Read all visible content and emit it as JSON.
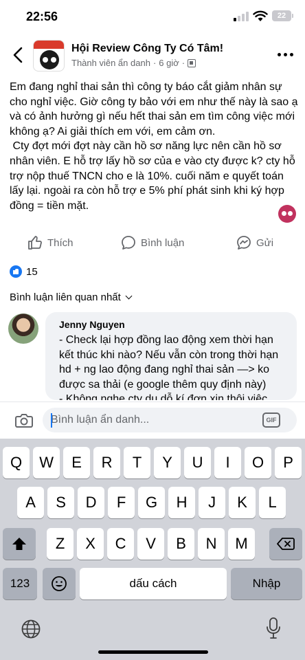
{
  "status_bar": {
    "time": "22:56",
    "battery": "22"
  },
  "header": {
    "group_name": "Hội Review Công Ty Có Tâm!",
    "author": "Thành viên ẩn danh",
    "separator": "·",
    "time_ago": "6 giờ",
    "separator2": "·"
  },
  "post": {
    "text": "Em đang nghỉ thai sản thì công ty báo cắt giảm nhân sự cho nghỉ việc. Giờ công ty bảo với em như thế này là sao ạ và có ảnh hưởng gì nếu hết thai sản em tìm công việc mới không ạ? Ai giải thích em với, em cảm ơn.\n Cty đợt mới đợt này cần hồ sơ năng lực nên cần hồ sơ nhân viên. E hỗ trợ lấy hồ sơ của e vào cty được k? cty hỗ trợ nộp thuế TNCN cho e là 10%. cuối năm e quyết toán lấy lại. ngoài ra còn hỗ trợ e 5% phí phát sinh khi ký hợp đồng = tiền mặt."
  },
  "actions": {
    "like": "Thích",
    "comment": "Bình luận",
    "send": "Gửi"
  },
  "reactions": {
    "count": "15"
  },
  "comments_sort": "Bình luận liên quan nhất",
  "comment": {
    "author": "Jenny Nguyen",
    "text": "- Check lại hợp đồng lao động xem thời hạn kết thúc khi nào? Nếu vẫn còn trong thời hạn hd + ng lao động đang nghỉ thai sản —> ko được sa thải (e google thêm quy định này)\n- Không nghe cty du dỗ kí đơn xin thôi việc"
  },
  "composer": {
    "placeholder": "Bình luận ẩn danh...",
    "gif_label": "GIF"
  },
  "keyboard": {
    "row1": [
      "Q",
      "W",
      "E",
      "R",
      "T",
      "Y",
      "U",
      "I",
      "O",
      "P"
    ],
    "row2": [
      "A",
      "S",
      "D",
      "F",
      "G",
      "H",
      "J",
      "K",
      "L"
    ],
    "row3": [
      "Z",
      "X",
      "C",
      "V",
      "B",
      "N",
      "M"
    ],
    "numbers_label": "123",
    "space_label": "dấu cách",
    "return_label": "Nhập"
  },
  "colors": {
    "brand_blue": "#1877f2",
    "secondary_text": "#65676b",
    "bubble_bg": "#f0f2f5",
    "keyboard_bg": "#d1d3d9"
  },
  "icons": [
    "back-icon",
    "more-icon",
    "like-icon",
    "comment-icon",
    "send-icon",
    "camera-icon",
    "gif-icon",
    "shift-icon",
    "delete-icon",
    "emoji-icon",
    "globe-icon",
    "mic-icon"
  ]
}
